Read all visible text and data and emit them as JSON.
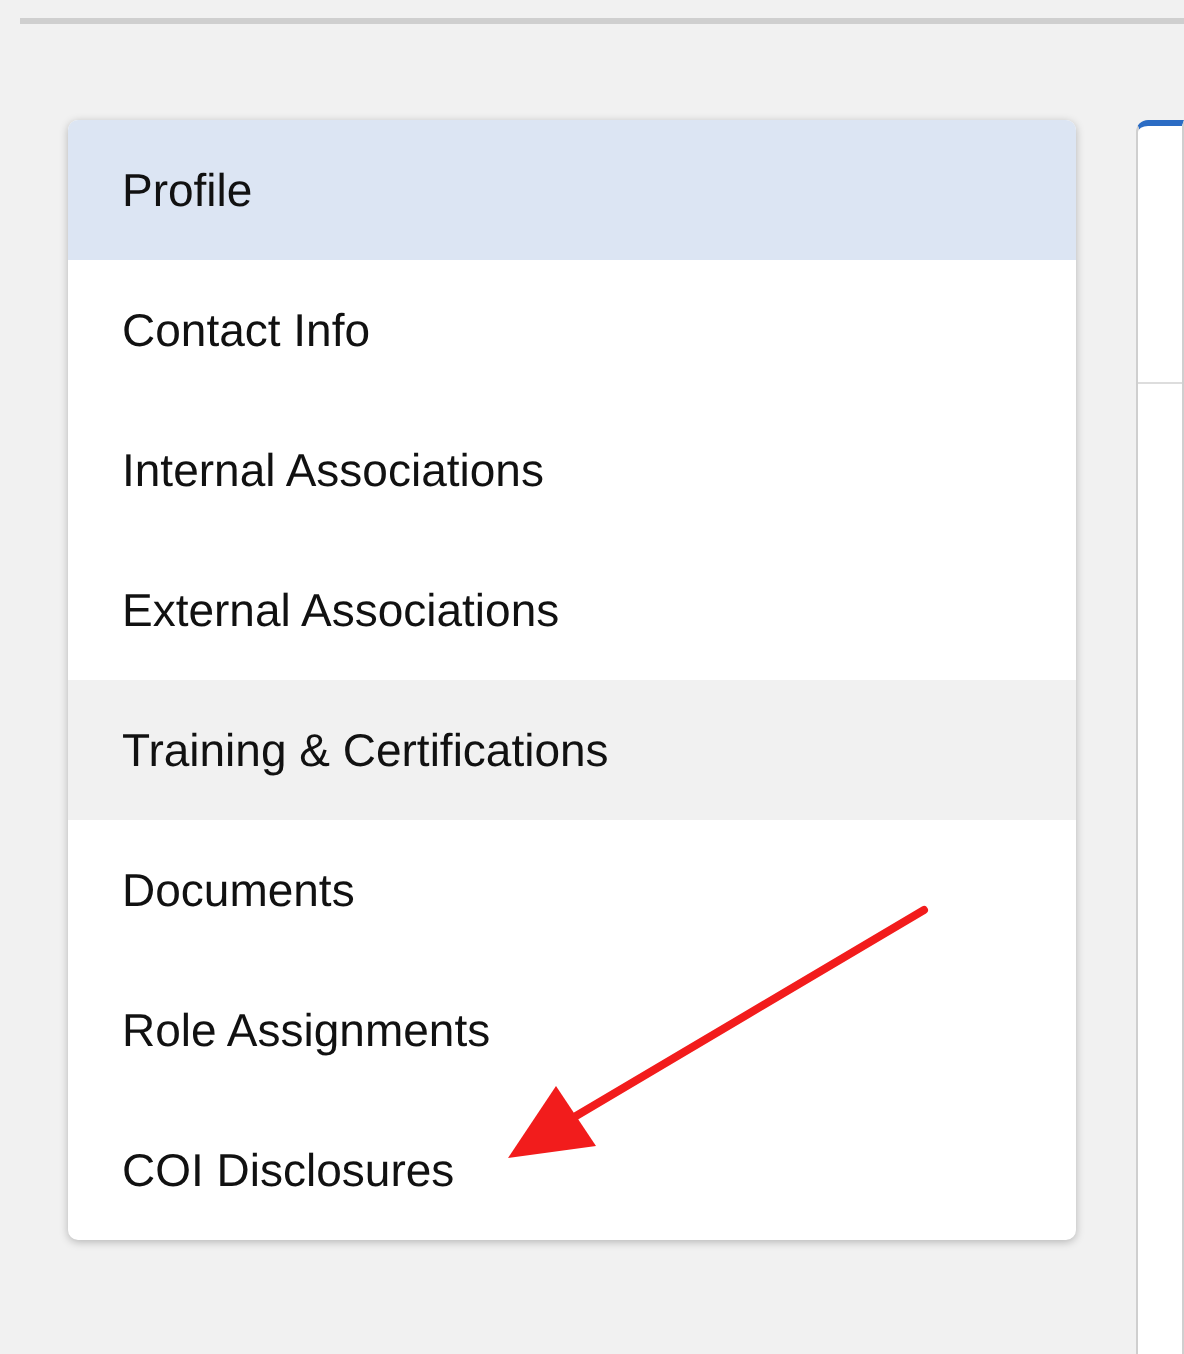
{
  "sidebar": {
    "items": [
      {
        "label": "Profile",
        "selected": true,
        "hovered": false
      },
      {
        "label": "Contact Info",
        "selected": false,
        "hovered": false
      },
      {
        "label": "Internal Associations",
        "selected": false,
        "hovered": false
      },
      {
        "label": "External Associations",
        "selected": false,
        "hovered": false
      },
      {
        "label": "Training & Certifications",
        "selected": false,
        "hovered": true
      },
      {
        "label": "Documents",
        "selected": false,
        "hovered": false
      },
      {
        "label": "Role Assignments",
        "selected": false,
        "hovered": false
      },
      {
        "label": "COI Disclosures",
        "selected": false,
        "hovered": false
      }
    ]
  }
}
